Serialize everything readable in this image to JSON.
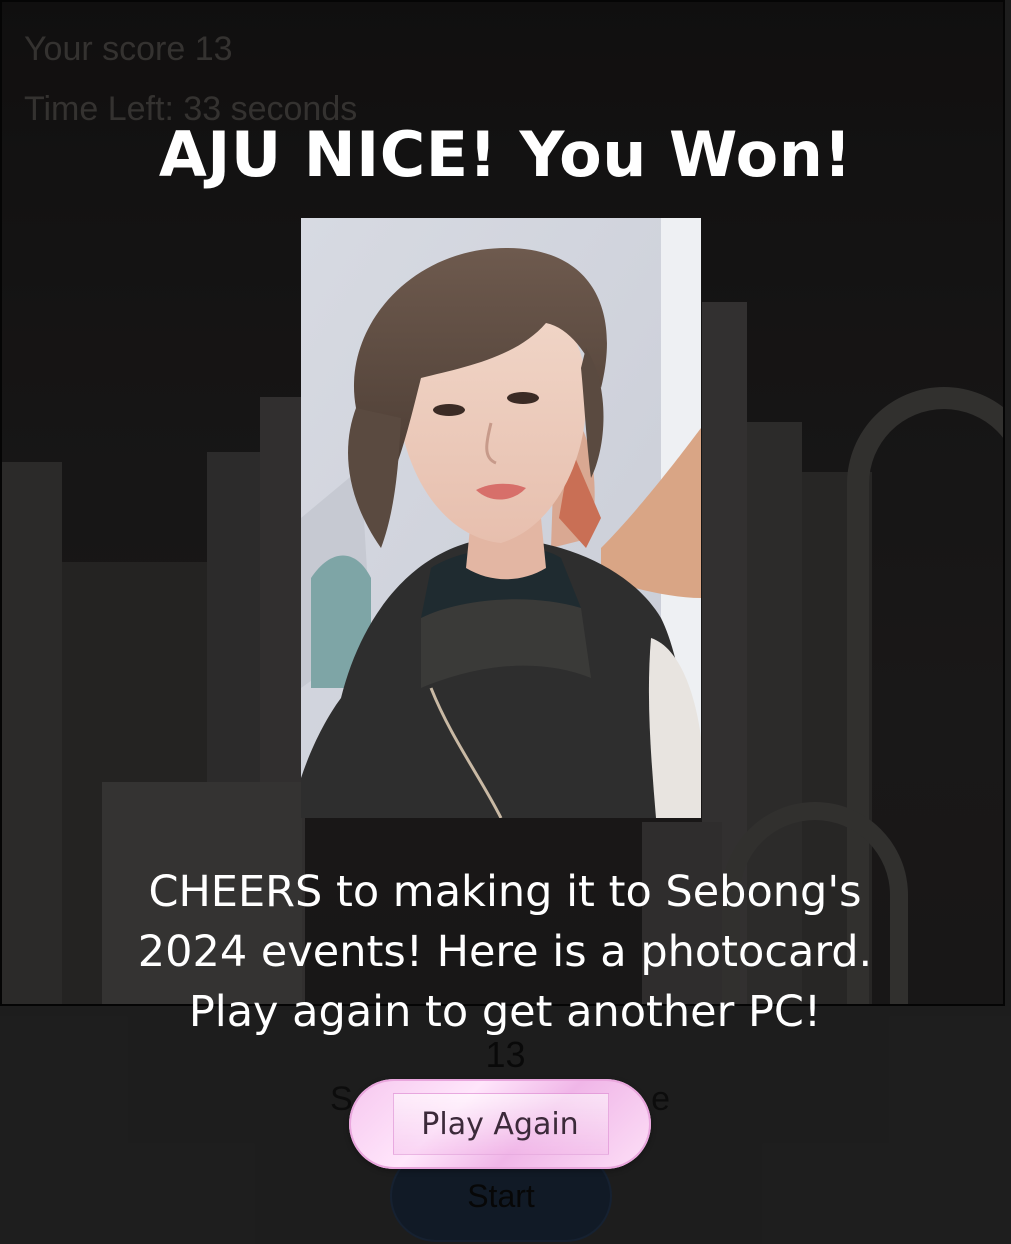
{
  "hud": {
    "score_text": "Your score 13",
    "time_text": "Time Left: 33 seconds"
  },
  "modal": {
    "title": "AJU NICE! You Won!",
    "message": "CHEERS to making it to Sebong's 2024 events! Here is a photocard. Play again to get another PC!",
    "play_again_label": "Play Again"
  },
  "results": {
    "score_value": "13",
    "score_label_left": "S",
    "score_label_right": "e",
    "start_label": "Start"
  },
  "colors": {
    "accent_pink": "#f6c7ef",
    "page_background": "#333333",
    "start_button": "#1e2e43"
  }
}
